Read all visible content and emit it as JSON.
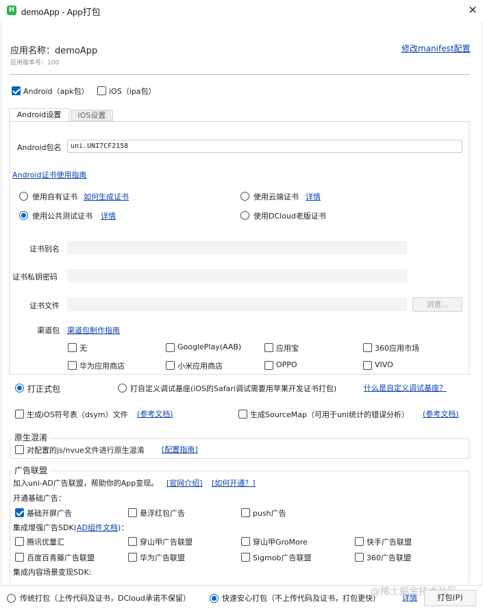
{
  "window": {
    "title": "demoApp - App打包",
    "icon_letter": "H"
  },
  "header": {
    "app_name": "应用名称：demoApp",
    "version": "应用版本号：100",
    "edit_manifest": "修改manifest配置"
  },
  "platforms": {
    "android": "Android（apk包）",
    "ios": "iOS（ipa包）"
  },
  "tabs": {
    "android": "Android设置",
    "ios": "iOS设置"
  },
  "android": {
    "package_label": "Android包名",
    "package_value": "uni.UNI7CF2158",
    "cert_guide": "Android证书使用指南",
    "own_cert": "使用自有证书",
    "own_cert_link": "如何生成证书",
    "cloud_cert": "使用云端证书",
    "cloud_cert_link": "详情",
    "public_cert": "使用公共测试证书",
    "public_cert_link": "详情",
    "dcloud_cert": "使用DCloud老版证书",
    "alias_label": "证书别名",
    "password_label": "证书私钥密码",
    "file_label": "证书文件",
    "browse": "浏览...",
    "channel_label": "渠道包",
    "channel_guide": "渠道包制作指南",
    "channels": [
      "无",
      "GooglePlay(AAB)",
      "应用宝",
      "360应用市场",
      "华为应用商店",
      "小米应用商店",
      "OPPO",
      "VIVO"
    ]
  },
  "build_mode": {
    "formal": "打正式包",
    "custom": "打自定义调试基座(iOS的Safari调试需要用苹果开发证书打包)",
    "custom_link": "什么是自定义调试基座？"
  },
  "symbols": {
    "dsym": "生成iOS符号表（dsym）文件",
    "dsym_link": "(参考文档)",
    "sourcemap": "生成SourceMap（可用于uni统计的错误分析）",
    "sourcemap_link": "(参考文档)"
  },
  "obfuscation": {
    "title": "原生混淆",
    "option": "对配置的js/nvue文件进行原生混淆",
    "link": "[配置指南]"
  },
  "ads": {
    "title": "广告联盟",
    "intro": "加入uni-AD广告联盟，帮助你的App变现。",
    "intro_link1": "[官网介绍]",
    "intro_link2": "[如何开通？]",
    "basic_label": "开通基础广告：",
    "basic": [
      "基础开屏广告",
      "悬浮红包广告",
      "push广告"
    ],
    "sdk_label_prefix": "集成增强广告SDK(",
    "sdk_label_link": "AD组件文档",
    "sdk_label_suffix": ")：",
    "sdk": [
      "腾讯优量汇",
      "穿山甲广告联盟",
      "穿山甲GroMore",
      "快手广告联盟",
      "百度百青藤广告联盟",
      "华为广告联盟",
      "Sigmob广告联盟",
      "360广告联盟"
    ],
    "content_label": "集成内容场景变现SDK:"
  },
  "bottom": {
    "traditional": "传统打包（上传代码及证书，DCloud承诺不保留）",
    "safe": "快速安心打包（不上传代码及证书，打包更快）",
    "safe_link": "详情",
    "pack_button": "打包(P)",
    "watermark": "@稀土掘金技术社区"
  }
}
